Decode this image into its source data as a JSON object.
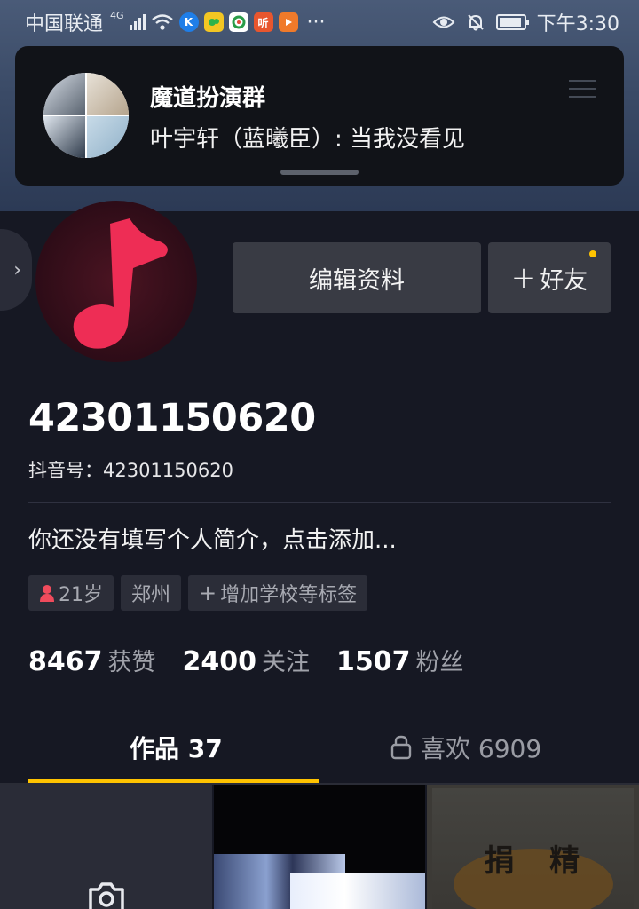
{
  "status_bar": {
    "carrier": "中国联通",
    "network_gen": "4G",
    "app_icons": [
      "k-app-icon",
      "green-app-icon",
      "browser-icon",
      "ting-app-icon",
      "video-app-icon"
    ],
    "more": "···",
    "time": "下午3:30"
  },
  "notification": {
    "title": "魔道扮演群",
    "message": "叶宇轩（蓝曦臣）: 当我没看见"
  },
  "profile": {
    "edit_label": "编辑资料",
    "friend_label": "好友",
    "friend_plus": "+",
    "username": "42301150620",
    "douyin_id": "抖音号：42301150620",
    "bio": "你还没有填写个人简介，点击添加...",
    "tags": {
      "age": "21岁",
      "city": "郑州",
      "add_plus": "+",
      "add_tag": "增加学校等标签"
    },
    "stats": {
      "likes_count": "8467",
      "likes_label": "获赞",
      "following_count": "2400",
      "following_label": "关注",
      "followers_count": "1507",
      "followers_label": "粉丝"
    }
  },
  "tabs": {
    "works": "作品 37",
    "likes": "喜欢 6909"
  },
  "grid": {
    "poster_text": "捐 精"
  },
  "colors": {
    "background": "#161823",
    "accent": "#ffc300",
    "brand_red": "#fe2c55",
    "button_bg": "#393b44"
  }
}
